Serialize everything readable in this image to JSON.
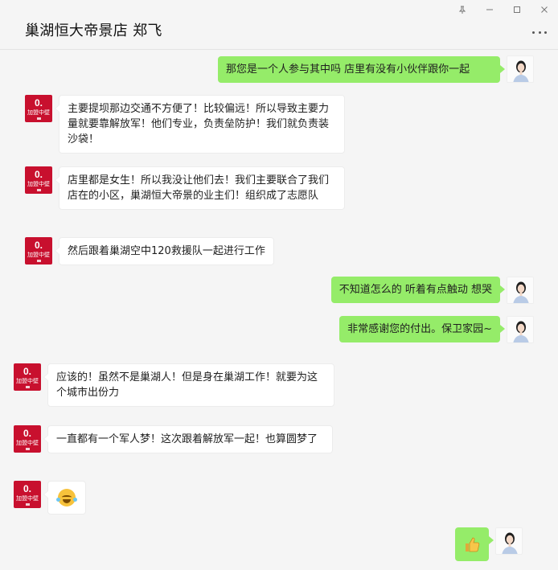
{
  "window": {
    "title": "巢湖恒大帝景店 郑飞",
    "controls": [
      "pin-icon",
      "minimize-icon",
      "maximize-icon",
      "close-icon"
    ]
  },
  "colors": {
    "background": "#f5f5f5",
    "bubble_self": "#95ec69",
    "bubble_other": "#ffffff",
    "brand_red": "#c8102e"
  },
  "brand": {
    "logo_text": "0.",
    "name_text": "加盟中壁"
  },
  "messages": [
    {
      "side": "right",
      "text": "那您是一个人参与其中吗  店里有没有小伙伴跟你一起"
    },
    {
      "side": "left",
      "text": "主要提坝那边交通不方便了！比较偏远！所以导致主要力量就要靠解放军！他们专业，负责垒防护！我们就负责装沙袋！"
    },
    {
      "side": "left",
      "text": "店里都是女生！所以我没让他们去！我们主要联合了我们店在的小区，巢湖恒大帝景的业主们！组织成了志愿队"
    },
    {
      "side": "left",
      "text": "然后跟着巢湖空中120救援队一起进行工作"
    },
    {
      "side": "right",
      "text": "不知道怎么的 听着有点触动 想哭"
    },
    {
      "side": "right",
      "text": "非常感谢您的付出。保卫家园~"
    },
    {
      "side": "left",
      "text": "应该的！虽然不是巢湖人！但是身在巢湖工作！就要为这个城市出份力"
    },
    {
      "side": "left",
      "text": "一直都有一个军人梦！这次跟着解放军一起！也算圆梦了"
    },
    {
      "side": "left",
      "emoji": "crying-laughing-emoji"
    },
    {
      "side": "right",
      "emoji": "thumbs-up-emoji"
    }
  ]
}
